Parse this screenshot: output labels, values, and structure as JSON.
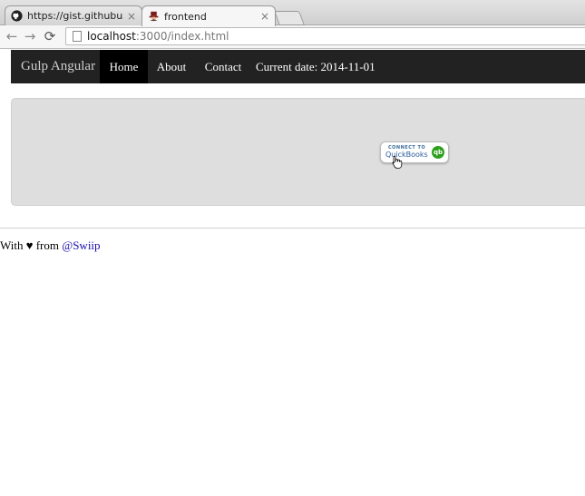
{
  "browser": {
    "tabs": [
      {
        "title": "https://gist.githubusercon",
        "icon": "github-icon",
        "active": false
      },
      {
        "title": "frontend",
        "icon": "mustache-hat-icon",
        "active": true
      }
    ],
    "close_glyph": "×",
    "url_host": "localhost",
    "url_rest": ":3000/index.html",
    "nav": {
      "back": "←",
      "forward": "→",
      "reload": "⟳"
    }
  },
  "navbar": {
    "brand": "Gulp Angular",
    "items": [
      {
        "label": "Home",
        "active": true
      },
      {
        "label": "About"
      },
      {
        "label": "Contact"
      }
    ],
    "current_date": "Current date: 2014-11-01"
  },
  "qb_button": {
    "top_text": "CONNECT TO",
    "brand": "QuickBooks",
    "logo_text": "qb"
  },
  "footer": {
    "prefix": "With",
    "heart": "♥",
    "from": "from",
    "link": "@Swiip"
  },
  "colors": {
    "navbar_bg": "#222222",
    "jumbotron_bg": "#dedede",
    "link": "#1a0dab",
    "qb_green": "#2ca01c"
  }
}
